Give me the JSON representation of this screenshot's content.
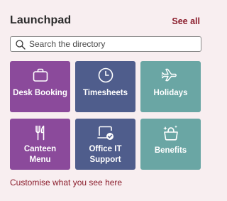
{
  "header": {
    "title": "Launchpad",
    "see_all_label": "See all"
  },
  "search": {
    "placeholder": "Search the directory",
    "value": ""
  },
  "tiles": [
    {
      "label": "Desk Booking",
      "icon": "briefcase-icon",
      "color": "#8b4a9b"
    },
    {
      "label": "Timesheets",
      "icon": "clock-icon",
      "color": "#4f5d8c"
    },
    {
      "label": "Holidays",
      "icon": "airplane-icon",
      "color": "#6aa6a4"
    },
    {
      "label": "Canteen Menu",
      "icon": "fork-knife-icon",
      "color": "#8b4a9b"
    },
    {
      "label": "Office IT Support",
      "icon": "laptop-check-icon",
      "color": "#4f5d8c"
    },
    {
      "label": "Benefits",
      "icon": "gift-basket-icon",
      "color": "#6aa6a4"
    }
  ],
  "footer": {
    "customise_label": "Customise what you see here"
  },
  "colors": {
    "background": "#f8eef0",
    "accent": "#8a1c2b",
    "purple": "#8b4a9b",
    "navy": "#4f5d8c",
    "teal": "#6aa6a4"
  }
}
